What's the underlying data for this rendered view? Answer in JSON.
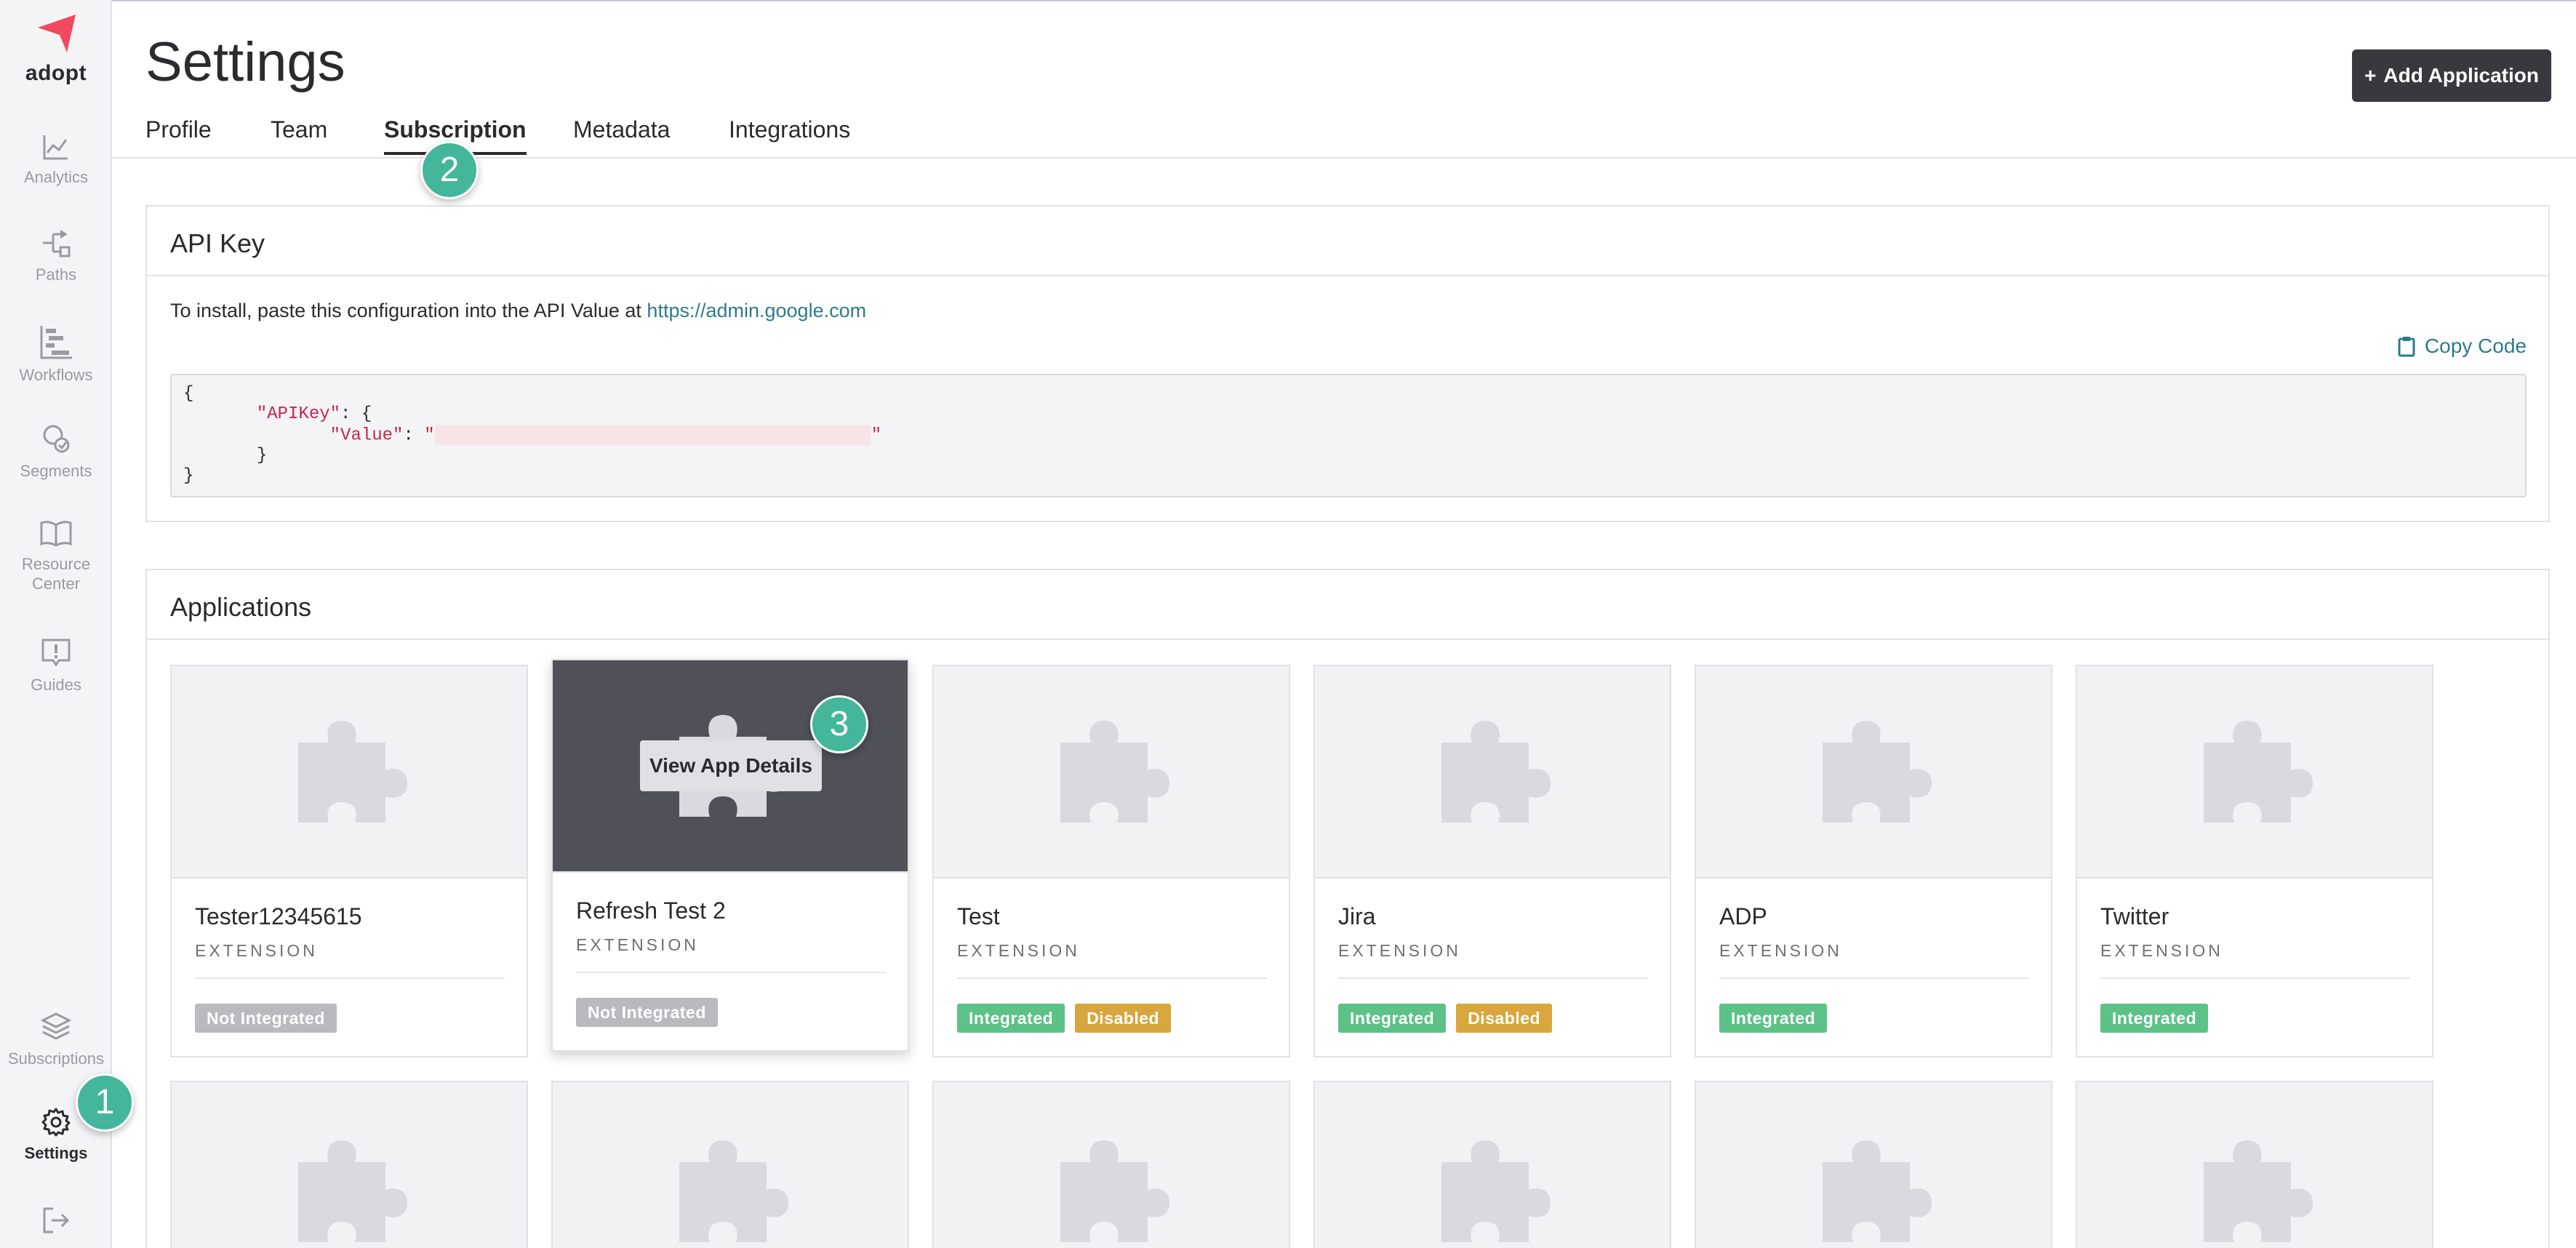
{
  "app": {
    "brand": "adopt",
    "accent": "#ef4a5f"
  },
  "sidebar": {
    "items": [
      {
        "label": "Analytics",
        "icon": "analytics-icon"
      },
      {
        "label": "Paths",
        "icon": "paths-icon"
      },
      {
        "label": "Workflows",
        "icon": "workflows-icon"
      },
      {
        "label": "Segments",
        "icon": "segments-icon"
      },
      {
        "label": "Resource Center",
        "icon": "book-icon"
      },
      {
        "label": "Guides",
        "icon": "guides-icon"
      }
    ],
    "bottom": [
      {
        "label": "Subscriptions",
        "icon": "layers-icon"
      },
      {
        "label": "Settings",
        "icon": "gear-icon",
        "active": true
      }
    ],
    "logout_icon": "logout-icon"
  },
  "header": {
    "title": "Settings",
    "add_button": "Add Application",
    "tabs": [
      {
        "label": "Profile"
      },
      {
        "label": "Team"
      },
      {
        "label": "Subscription",
        "active": true
      },
      {
        "label": "Metadata"
      },
      {
        "label": "Integrations"
      }
    ]
  },
  "api_panel": {
    "title": "API Key",
    "install_text": "To install, paste this configuration into the API Value at",
    "install_link": "https://admin.google.com",
    "copy_label": "Copy Code",
    "code_open": "{",
    "code_key1": "\"APIKey\"",
    "code_key2": "\"Value\"",
    "code_close": "}"
  },
  "applications": {
    "title": "Applications",
    "overlay_button": "View App Details",
    "cards": [
      {
        "name": "Tester12345615",
        "type": "EXTENSION",
        "badges": [
          {
            "text": "Not Integrated",
            "kind": "not-integrated"
          }
        ]
      },
      {
        "name": "Refresh Test 2",
        "type": "EXTENSION",
        "badges": [
          {
            "text": "Not Integrated",
            "kind": "not-integrated"
          }
        ],
        "hovered": true
      },
      {
        "name": "Test",
        "type": "EXTENSION",
        "badges": [
          {
            "text": "Integrated",
            "kind": "integrated"
          },
          {
            "text": "Disabled",
            "kind": "disabled"
          }
        ]
      },
      {
        "name": "Jira",
        "type": "EXTENSION",
        "badges": [
          {
            "text": "Integrated",
            "kind": "integrated"
          },
          {
            "text": "Disabled",
            "kind": "disabled"
          }
        ]
      },
      {
        "name": "ADP",
        "type": "EXTENSION",
        "badges": [
          {
            "text": "Integrated",
            "kind": "integrated"
          }
        ]
      },
      {
        "name": "Twitter",
        "type": "EXTENSION",
        "badges": [
          {
            "text": "Integrated",
            "kind": "integrated"
          }
        ]
      }
    ]
  },
  "callouts": [
    "1",
    "2",
    "3"
  ]
}
